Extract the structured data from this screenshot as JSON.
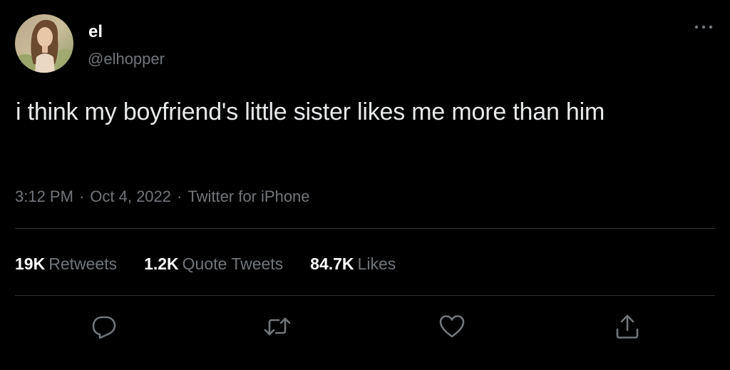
{
  "user": {
    "display_name": "el",
    "handle": "@elhopper"
  },
  "tweet": {
    "text": "i think my boyfriend's little sister likes me more than him",
    "time": "3:12 PM",
    "separator": "·",
    "date": "Oct 4, 2022",
    "source": "Twitter for iPhone"
  },
  "stats": {
    "retweets": {
      "count": "19K",
      "label": "Retweets"
    },
    "quote_tweets": {
      "count": "1.2K",
      "label": "Quote Tweets"
    },
    "likes": {
      "count": "84.7K",
      "label": "Likes"
    }
  },
  "colors": {
    "background": "#000000",
    "text": "#e7e9ea",
    "secondary": "#71767b",
    "divider": "#2f3336"
  },
  "icons": {
    "more": "more-horizontal-icon",
    "reply": "reply-icon",
    "retweet": "retweet-icon",
    "like": "heart-icon",
    "share": "share-icon"
  }
}
